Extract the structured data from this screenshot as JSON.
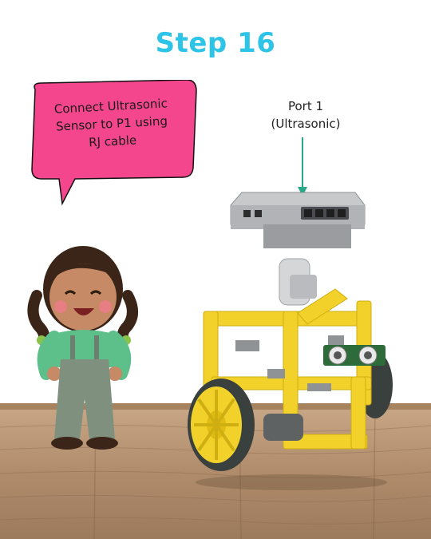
{
  "header": {
    "title": "Step 16"
  },
  "instruction": {
    "lines": [
      "Connect Ultrasonic",
      "Sensor to P1 using",
      "RJ cable"
    ]
  },
  "port_label": {
    "line1": "Port 1",
    "line2": "(Ultrasonic)"
  },
  "colors": {
    "title": "#2ec4e8",
    "bubble": "#f4468c",
    "arrow": "#2aa98a",
    "robot_frame": "#f2d22a",
    "controller": "#a9abad",
    "wood": "#b08c6c"
  },
  "icons": [
    "speech-bubble-icon",
    "arrow-down-icon",
    "controller-module-icon",
    "robot-car-icon",
    "girl-illustration-icon"
  ]
}
